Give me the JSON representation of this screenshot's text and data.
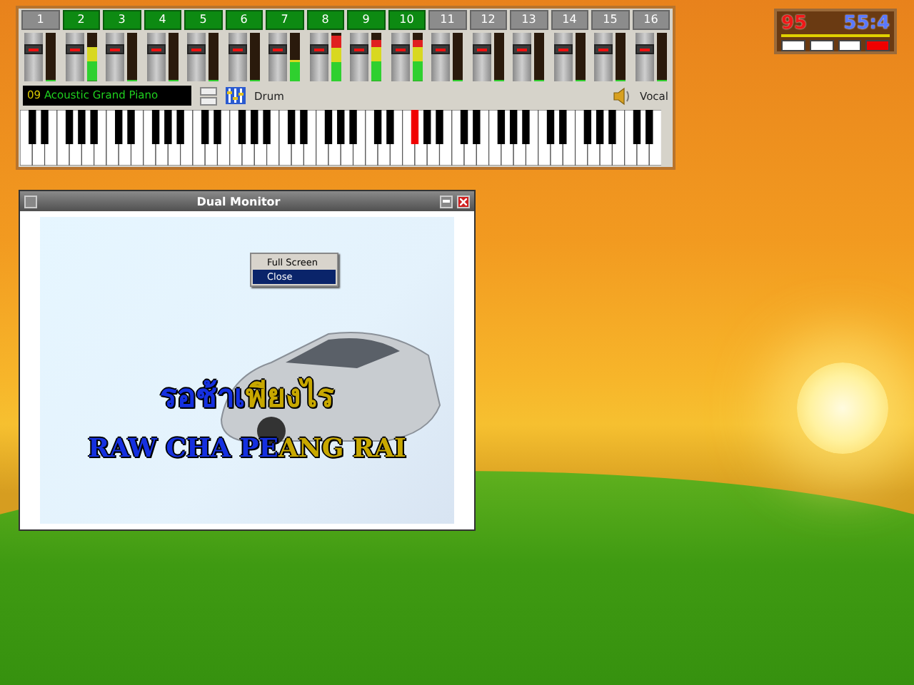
{
  "mixer": {
    "channels": [
      {
        "label": "1",
        "active": false,
        "level": 0
      },
      {
        "label": "2",
        "active": true,
        "level": 0.7
      },
      {
        "label": "3",
        "active": true,
        "level": 0
      },
      {
        "label": "4",
        "active": true,
        "level": 0
      },
      {
        "label": "5",
        "active": true,
        "level": 0
      },
      {
        "label": "6",
        "active": true,
        "level": 0
      },
      {
        "label": "7",
        "active": true,
        "level": 0.45
      },
      {
        "label": "8",
        "active": true,
        "level": 0.95
      },
      {
        "label": "9",
        "active": true,
        "level": 0.85
      },
      {
        "label": "10",
        "active": true,
        "level": 0.85
      },
      {
        "label": "11",
        "active": false,
        "level": 0
      },
      {
        "label": "12",
        "active": false,
        "level": 0
      },
      {
        "label": "13",
        "active": false,
        "level": 0
      },
      {
        "label": "14",
        "active": false,
        "level": 0
      },
      {
        "label": "15",
        "active": false,
        "level": 0
      },
      {
        "label": "16",
        "active": false,
        "level": 0
      }
    ],
    "instrument": {
      "number": "09",
      "name": "Acoustic Grand Piano"
    },
    "drum_label": "Drum",
    "vocal_label": "Vocal",
    "keyboard": {
      "octaves": [
        {
          "pressed": [
            false,
            false,
            false,
            false,
            false,
            false,
            false,
            false,
            false,
            false,
            false,
            false
          ]
        },
        {
          "pressed": [
            false,
            false,
            false,
            false,
            false,
            false,
            false,
            false,
            false,
            false,
            false,
            false
          ]
        },
        {
          "pressed": [
            false,
            false,
            false,
            false,
            false,
            false,
            false,
            false,
            false,
            false,
            false,
            false
          ]
        },
        {
          "pressed": [
            false,
            false,
            false,
            false,
            false,
            false,
            false,
            false,
            false,
            false,
            false,
            false
          ]
        },
        {
          "pressed": [
            false,
            false,
            false,
            false,
            false,
            false,
            true,
            false,
            false,
            false,
            false,
            false
          ]
        },
        {
          "pressed": [
            false,
            false,
            false,
            false,
            false,
            false,
            false,
            false,
            false,
            false,
            false,
            false
          ]
        },
        {
          "pressed": [
            false,
            false,
            false,
            false,
            false,
            false,
            false,
            false,
            false,
            false,
            false,
            false
          ]
        },
        {
          "pressed": [
            false,
            false,
            false,
            false,
            false
          ]
        }
      ]
    }
  },
  "scoreboard": {
    "score": "95",
    "time": "55:4",
    "lights": [
      {
        "on": false
      },
      {
        "on": false
      },
      {
        "on": false
      },
      {
        "on": true
      }
    ]
  },
  "dual_monitor": {
    "title": "Dual Monitor",
    "context_menu": [
      {
        "label": "Full Screen",
        "selected": false
      },
      {
        "label": "Close",
        "selected": true
      }
    ],
    "lyrics": [
      {
        "sung": "รอช้าเ",
        "rest": "พียงไร"
      },
      {
        "sung": "RAW CHA PE",
        "rest": "ANG RAI"
      }
    ]
  }
}
